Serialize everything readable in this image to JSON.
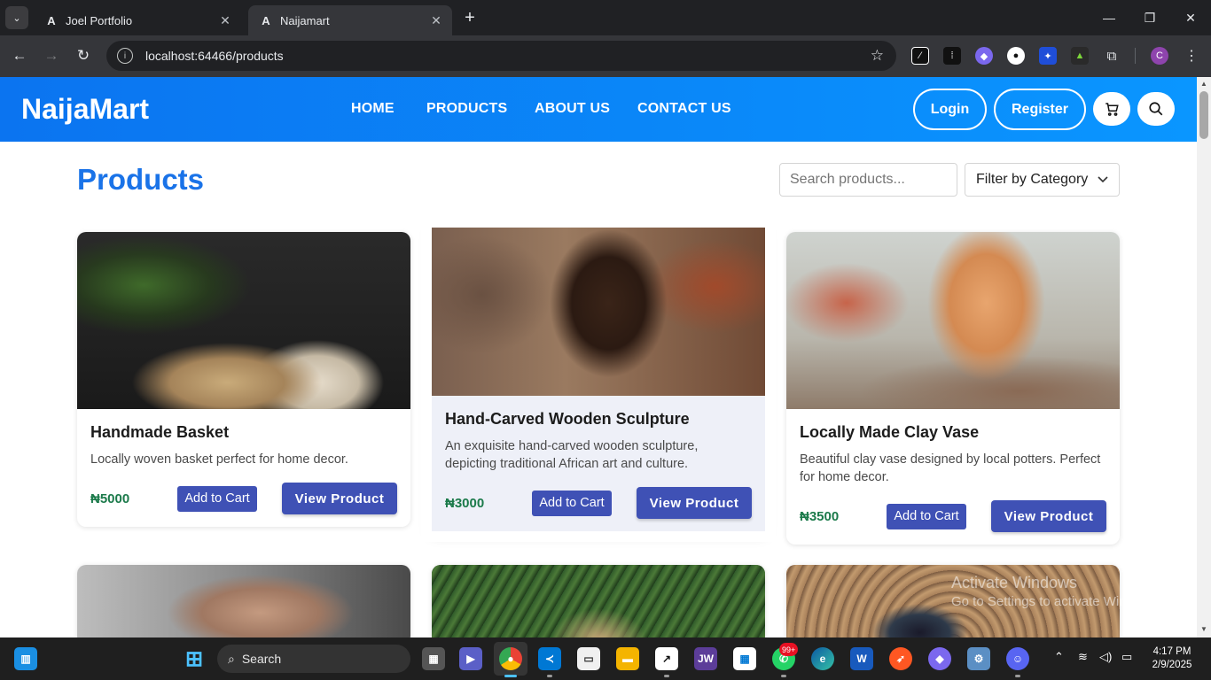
{
  "browser": {
    "tabs": [
      {
        "title": "Joel Portfolio",
        "active": false
      },
      {
        "title": "Naijamart",
        "active": true
      }
    ],
    "url": "localhost:64466/products",
    "profile_initial": "C"
  },
  "site": {
    "brand": "NaijaMart",
    "nav": [
      "HOME",
      "PRODUCTS",
      "ABOUT US",
      "CONTACT US"
    ],
    "login_label": "Login",
    "register_label": "Register"
  },
  "page": {
    "title": "Products",
    "search_placeholder": "Search products...",
    "filter_label": "Filter by Category"
  },
  "products": [
    {
      "name": "Handmade Basket",
      "description": "Locally woven basket perfect for home decor.",
      "price": "₦5000",
      "add_label": "Add to Cart",
      "view_label": "View Product"
    },
    {
      "name": "Hand-Carved Wooden Sculpture",
      "description": "An exquisite hand-carved wooden sculpture, depicting traditional African art and culture.",
      "price": "₦3000",
      "add_label": "Add to Cart",
      "view_label": "View Product"
    },
    {
      "name": "Locally Made Clay Vase",
      "description": "Beautiful clay vase designed by local potters. Perfect for home decor.",
      "price": "₦3500",
      "add_label": "Add to Cart",
      "view_label": "View Product"
    }
  ],
  "watermark": {
    "line1": "Activate Windows",
    "line2": "Go to Settings to activate Windows."
  },
  "taskbar": {
    "search_label": "Search",
    "whatsapp_badge": "99+",
    "time": "4:17 PM",
    "date": "2/9/2025"
  },
  "colors": {
    "header_start": "#0b74f0",
    "header_end": "#0a96ff",
    "title_blue": "#1a73e8",
    "button_indigo": "#3f51b5",
    "price_green": "#1b7a4a"
  }
}
